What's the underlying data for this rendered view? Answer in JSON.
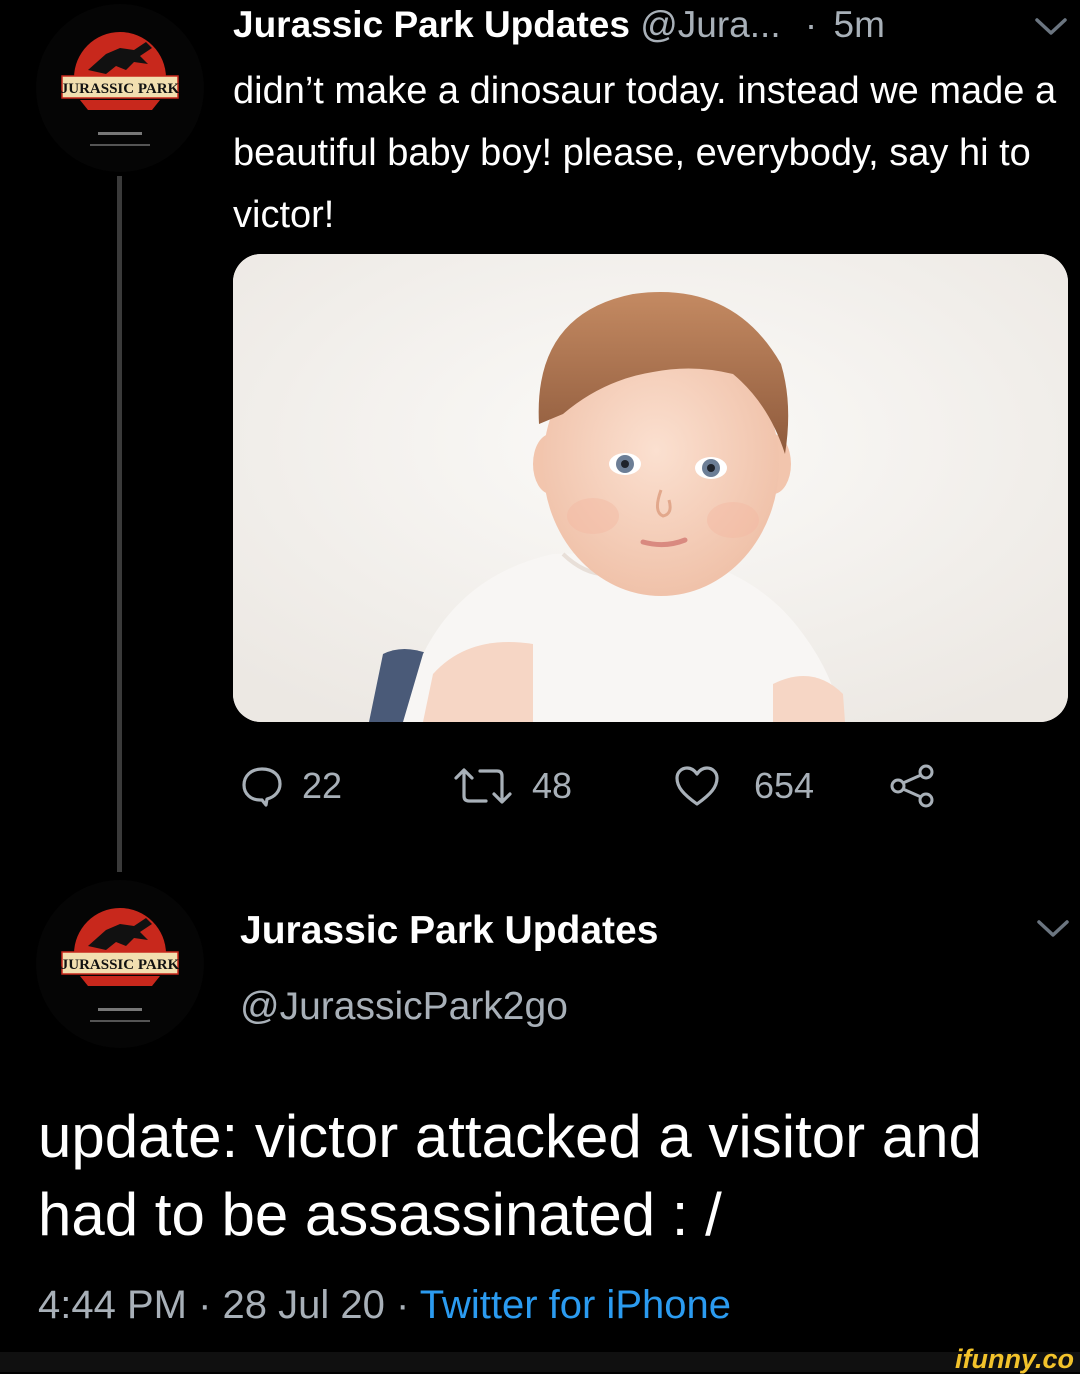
{
  "tweet1": {
    "display_name": "Jurassic Park Updates",
    "handle": "@Jura...",
    "separator": "·",
    "time": "5m",
    "text": "didn’t make a dinosaur today. instead we made a beautiful baby boy! please, everybody, say hi to victor!",
    "actions": {
      "reply_count": "22",
      "retweet_count": "48",
      "like_count": "654"
    }
  },
  "tweet2": {
    "display_name": "Jurassic Park Updates",
    "handle": "@JurassicPark2go",
    "text": "update: victor attacked a visitor and had to be assassinated : /",
    "time": "4:44 PM",
    "separator1": "·",
    "date": "28 Jul 20",
    "separator2": "·",
    "source": "Twitter for iPhone"
  },
  "avatar_logo_text": "JURASSIC PARK",
  "watermark": "ifunny.co",
  "colors": {
    "background": "#000000",
    "primary_text": "#ffffff",
    "secondary_text": "#a8b0b8",
    "link": "#2b9bf0",
    "logo_red": "#c8281c",
    "watermark": "#f3c32b"
  },
  "icons": [
    "reply-icon",
    "retweet-icon",
    "like-icon",
    "share-icon",
    "chevron-down-icon"
  ]
}
